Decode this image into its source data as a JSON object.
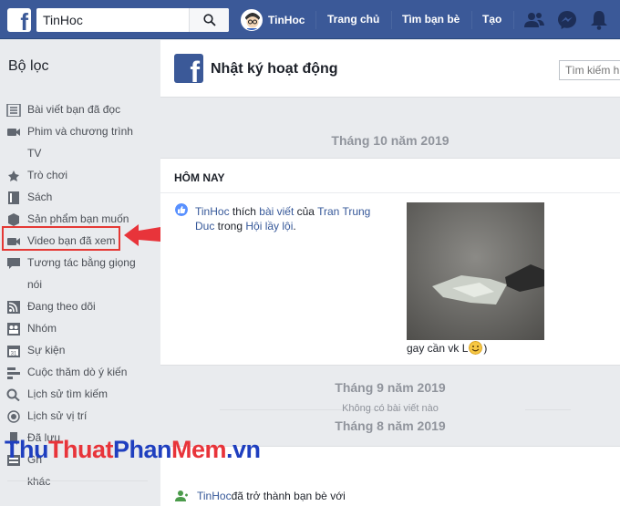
{
  "topbar": {
    "logo": "f",
    "search_value": "TinHoc",
    "search_icon": "search-icon",
    "profile_name": "TinHoc",
    "nav_home": "Trang chủ",
    "nav_find_friends": "Tìm bạn bè",
    "nav_create": "Tạo",
    "icons": [
      "friends-icon",
      "messenger-icon",
      "notifications-icon"
    ]
  },
  "sidebar": {
    "title": "Bộ lọc",
    "items": [
      {
        "label": "Bài viết bạn đã đọc",
        "icon": "list-icon"
      },
      {
        "label": "Phim và chương trình",
        "label2": "TV",
        "icon": "video-camera-icon"
      },
      {
        "label": "Trò chơi",
        "icon": "game-controller-icon"
      },
      {
        "label": "Sách",
        "icon": "book-icon"
      },
      {
        "label": "Sản phẩm bạn muốn",
        "icon": "product-icon"
      },
      {
        "label": "Video bạn đã xem",
        "icon": "video-camera-icon"
      },
      {
        "label": "Tương tác bằng giọng",
        "label2": "nói",
        "icon": "speech-bubble-icon"
      },
      {
        "label": "Đang theo dõi",
        "icon": "rss-icon"
      },
      {
        "label": "Nhóm",
        "icon": "group-icon"
      },
      {
        "label": "Sự kiện",
        "icon": "calendar-icon"
      },
      {
        "label": "Cuộc thăm dò ý kiến",
        "icon": "poll-icon"
      },
      {
        "label": "Lịch sử tìm kiếm",
        "icon": "search-icon"
      },
      {
        "label": "Lịch sử vị trí",
        "icon": "location-icon"
      },
      {
        "label": "Đã lưu",
        "icon": "bookmark-icon"
      },
      {
        "label": "Gh",
        "label2": "khác",
        "icon": "other-icon"
      }
    ],
    "highlight_color": "#e53935"
  },
  "main": {
    "header_title": "Nhật ký hoạt động",
    "header_search_placeholder": "Tìm kiếm h",
    "month_oct": "Tháng 10 năm 2019",
    "today_label": "HÔM NAY",
    "activity": {
      "actor": "TinHoc",
      "verb": " thích ",
      "object": "bài viết",
      "of": " của ",
      "author": "Tran Trung Duc",
      "in": " trong ",
      "group": "Hội lầy lội",
      "end": "."
    },
    "photo_caption_before": "gay cần vk L ",
    "photo_caption_after": ")",
    "month_sep": "Tháng 9 năm 2019",
    "no_posts": "Không có bài viết nào",
    "month_aug": "Tháng 8 năm 2019",
    "friend_activity": {
      "actor": "TinHoc",
      "text": " đã trở thành bạn bè với"
    }
  },
  "watermark": {
    "part1": "Thu",
    "part2": "Thuat",
    "part3": "Phan",
    "part4": "Mem",
    "part5": ".vn"
  },
  "colors": {
    "brand": "#3b5998",
    "link": "#365899",
    "background": "#e9ebee"
  }
}
